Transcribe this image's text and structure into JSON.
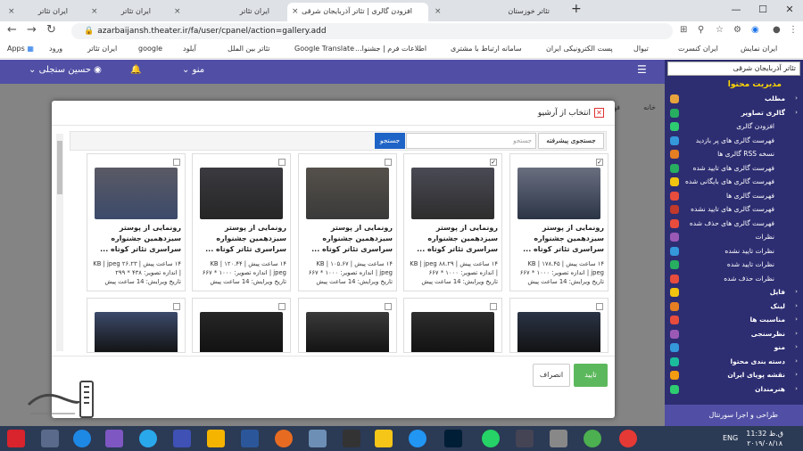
{
  "tabs": [
    {
      "label": "ایران تئاتر",
      "active": false
    },
    {
      "label": "ایران تئاتر",
      "active": false
    },
    {
      "label": "ایران تئاتر",
      "active": false
    },
    {
      "label": "افزودن گالری | تئاتر آذربایجان شرقی",
      "active": true
    },
    {
      "label": "تئاتر خوزستان",
      "active": false
    }
  ],
  "address": {
    "url": "azarbaijansh.theater.ir/fa/user/cpanel/action=gallery.add"
  },
  "bookmarks": {
    "apps": "Apps",
    "items": [
      "ورود",
      "ایران تئاتر",
      "google",
      "آیلود",
      "تئاتر بین الملل",
      "Google Translate",
      "اطلاعات فرم | جشنوا...",
      "سامانه ارتباط با مشتری",
      "پست الکترونیکی ایران",
      "تیوال",
      "ایران کنسرت",
      "ایران نمایش"
    ]
  },
  "appbar": {
    "user": "حسین سنجلی",
    "menu": "منو"
  },
  "background": {
    "crumb": "خانه",
    "list": "فهرست"
  },
  "sidebar": {
    "select": "تئاتر آذربایجان شرقی",
    "header": "مدیریت محتوا",
    "items": [
      {
        "label": "مطلب",
        "sub": false,
        "color": "#e8a33c"
      },
      {
        "label": "گالری تصاویر",
        "sub": false,
        "color": "#27ae60"
      },
      {
        "label": "افزودن گالری",
        "sub": true,
        "color": "#2ecc71"
      },
      {
        "label": "فهرست گالری های پر بازدید",
        "sub": true,
        "color": "#3498db"
      },
      {
        "label": "نسخه RSS گالری ها",
        "sub": true,
        "color": "#e67e22"
      },
      {
        "label": "فهرست گالری های تایید شده",
        "sub": true,
        "color": "#27ae60"
      },
      {
        "label": "فهرست گالری های بایگانی شده",
        "sub": true,
        "color": "#f1c40f"
      },
      {
        "label": "فهرست گالری ها",
        "sub": true,
        "color": "#e74c3c"
      },
      {
        "label": "فهرست گالری های تایید نشده",
        "sub": true,
        "color": "#c0392b"
      },
      {
        "label": "فهرست گالری های حذف شده",
        "sub": true,
        "color": "#e74c3c"
      },
      {
        "label": "نظرات",
        "sub": true,
        "color": "#9b59b6"
      },
      {
        "label": "نظرات تایید نشده",
        "sub": true,
        "color": "#3498db"
      },
      {
        "label": "نظرات تایید شده",
        "sub": true,
        "color": "#27ae60"
      },
      {
        "label": "نظرات حذف شده",
        "sub": true,
        "color": "#e74c3c"
      },
      {
        "label": "فایل",
        "sub": false,
        "color": "#f1c40f"
      },
      {
        "label": "لینک",
        "sub": false,
        "color": "#e67e22"
      },
      {
        "label": "مناسبت ها",
        "sub": false,
        "color": "#e74c3c"
      },
      {
        "label": "نظرسنجی",
        "sub": false,
        "color": "#9b59b6"
      },
      {
        "label": "منو",
        "sub": false,
        "color": "#3498db"
      },
      {
        "label": "دسته بندی محتوا",
        "sub": false,
        "color": "#1abc9c"
      },
      {
        "label": "نقشه پویای ایران",
        "sub": false,
        "color": "#f39c12"
      },
      {
        "label": "هنرمندان",
        "sub": false,
        "color": "#2ecc71"
      }
    ],
    "footer": "طراحی و اجرا سورنتال"
  },
  "modal": {
    "title": "انتخاب از آرشیو",
    "adv_search": "جستجوی پیشرفته",
    "search_placeholder": "جستجو",
    "search_btn": "جستجو",
    "ok": "تایید",
    "cancel": "انصراف",
    "cards": [
      {
        "checked": true,
        "title": "رونمایی از پوستر سیزدهمین جشنواره سراسری تئاتر کوتاه ...",
        "meta1": "۱۴ ساعت پیش | ۱۷۸.۴۵ KB | jpeg | اندازه تصویر: ۱۰۰۰ * ۶۶۷",
        "meta2": "تاریخ ویرایش: 14 ساعت پیش"
      },
      {
        "checked": true,
        "title": "رونمایی از پوستر سیزدهمین جشنواره سراسری تئاتر کوتاه ...",
        "meta1": "۱۴ ساعت پیش | ۸۸.۲۹ KB | jpeg | اندازه تصویر: ۱۰۰۰ * ۶۶۷",
        "meta2": "تاریخ ویرایش: 14 ساعت پیش"
      },
      {
        "checked": false,
        "title": "رونمایی از پوستر سیزدهمین جشنواره سراسری تئاتر کوتاه ...",
        "meta1": "۱۴ ساعت پیش | ۱۰۵.۶۷ KB | jpeg | اندازه تصویر: ۱۰۰۰ * ۶۶۷",
        "meta2": "تاریخ ویرایش: 14 ساعت پیش"
      },
      {
        "checked": false,
        "title": "رونمایی از پوستر سیزدهمین جشنواره سراسری تئاتر کوتاه ...",
        "meta1": "۱۴ ساعت پیش | ۱۲۰.۴۴ KB | jpeg | اندازه تصویر: ۱۰۰۰ * ۶۶۷",
        "meta2": "تاریخ ویرایش: 14 ساعت پیش"
      },
      {
        "checked": false,
        "title": "رونمایی از پوستر سیزدهمین جشنواره سراسری تئاتر کوتاه ...",
        "meta1": "۱۴ ساعت پیش | ۲۶.۲۳ KB | jpeg | اندازه تصویر: ۴۳۸ * ۲۹۹",
        "meta2": "تاریخ ویرایش: 14 ساعت پیش"
      }
    ]
  },
  "taskbar": {
    "lang": "ENG",
    "time": "11:32 ق.ظ",
    "date": "۲۰۱۹/۰۸/۱۸"
  }
}
